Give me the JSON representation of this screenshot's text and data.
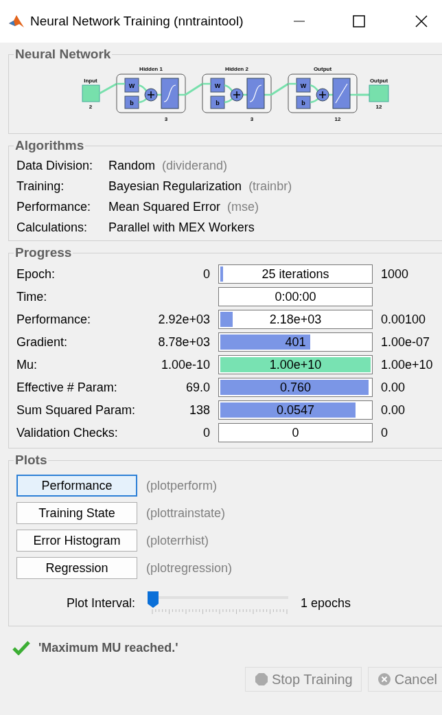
{
  "window": {
    "title": "Neural Network Training (nntraintool)"
  },
  "network": {
    "title": "Neural Network",
    "input": {
      "label": "Input",
      "size": "2"
    },
    "layers": [
      {
        "name": "Hidden 1",
        "size": "3",
        "weight": "W",
        "bias": "b",
        "kind": "sigmoid"
      },
      {
        "name": "Hidden 2",
        "size": "3",
        "weight": "W",
        "bias": "b",
        "kind": "sigmoid"
      },
      {
        "name": "Output",
        "size": "12",
        "weight": "W",
        "bias": "b",
        "kind": "linear"
      }
    ],
    "output": {
      "label": "Output",
      "size": "12"
    }
  },
  "algorithms": {
    "title": "Algorithms",
    "rows": [
      {
        "label": "Data Division:",
        "value": "Random",
        "hint": "(dividerand)"
      },
      {
        "label": "Training:",
        "value": "Bayesian Regularization",
        "hint": "(trainbr)"
      },
      {
        "label": "Performance:",
        "value": "Mean Squared Error",
        "hint": "(mse)"
      },
      {
        "label": "Calculations:",
        "value": "Parallel with MEX Workers"
      }
    ]
  },
  "progress": {
    "title": "Progress",
    "rows": [
      {
        "label": "Epoch:",
        "min": "0",
        "value": "25 iterations",
        "max": "1000",
        "level": 0.02
      },
      {
        "label": "Time:",
        "value": "0:00:00"
      },
      {
        "label": "Performance:",
        "min": "2.92e+03",
        "value": "2.18e+03",
        "max": "0.00100",
        "level": 0.08
      },
      {
        "label": "Gradient:",
        "min": "8.78e+03",
        "value": "401",
        "max": "1.00e-07",
        "level": 0.6
      },
      {
        "label": "Mu:",
        "min": "1.00e-10",
        "value": "1.00e+10",
        "max": "1.00e+10",
        "level": 1,
        "color": "#78e2b2"
      },
      {
        "label": "Effective # Param:",
        "min": "69.0",
        "value": "0.760",
        "max": "0.00",
        "level": 0.985
      },
      {
        "label": "Sum Squared Param:",
        "min": "138",
        "value": "0.0547",
        "max": "0.00",
        "level": 0.9
      },
      {
        "label": "Validation Checks:",
        "min": "0",
        "value": "0",
        "max": "0"
      }
    ]
  },
  "plots": {
    "title": "Plots",
    "buttons": [
      {
        "label": "Performance",
        "hint": "(plotperform)",
        "selected": true
      },
      {
        "label": "Training State",
        "hint": "(plottrainstate)",
        "selected": false
      },
      {
        "label": "Error Histogram",
        "hint": "(ploterrhist)",
        "selected": false
      },
      {
        "label": "Regression",
        "hint": "(plotregression)",
        "selected": false
      }
    ],
    "interval": {
      "label": "Plot Interval:",
      "level": 0,
      "reading": "1 epochs"
    }
  },
  "status": {
    "message": "'Maximum MU reached.'",
    "success": true
  },
  "buttons": [
    {
      "label": "Stop Training",
      "kind": "stop",
      "disabled": true
    },
    {
      "label": "Cancel",
      "kind": "cancel",
      "disabled": true
    }
  ]
}
